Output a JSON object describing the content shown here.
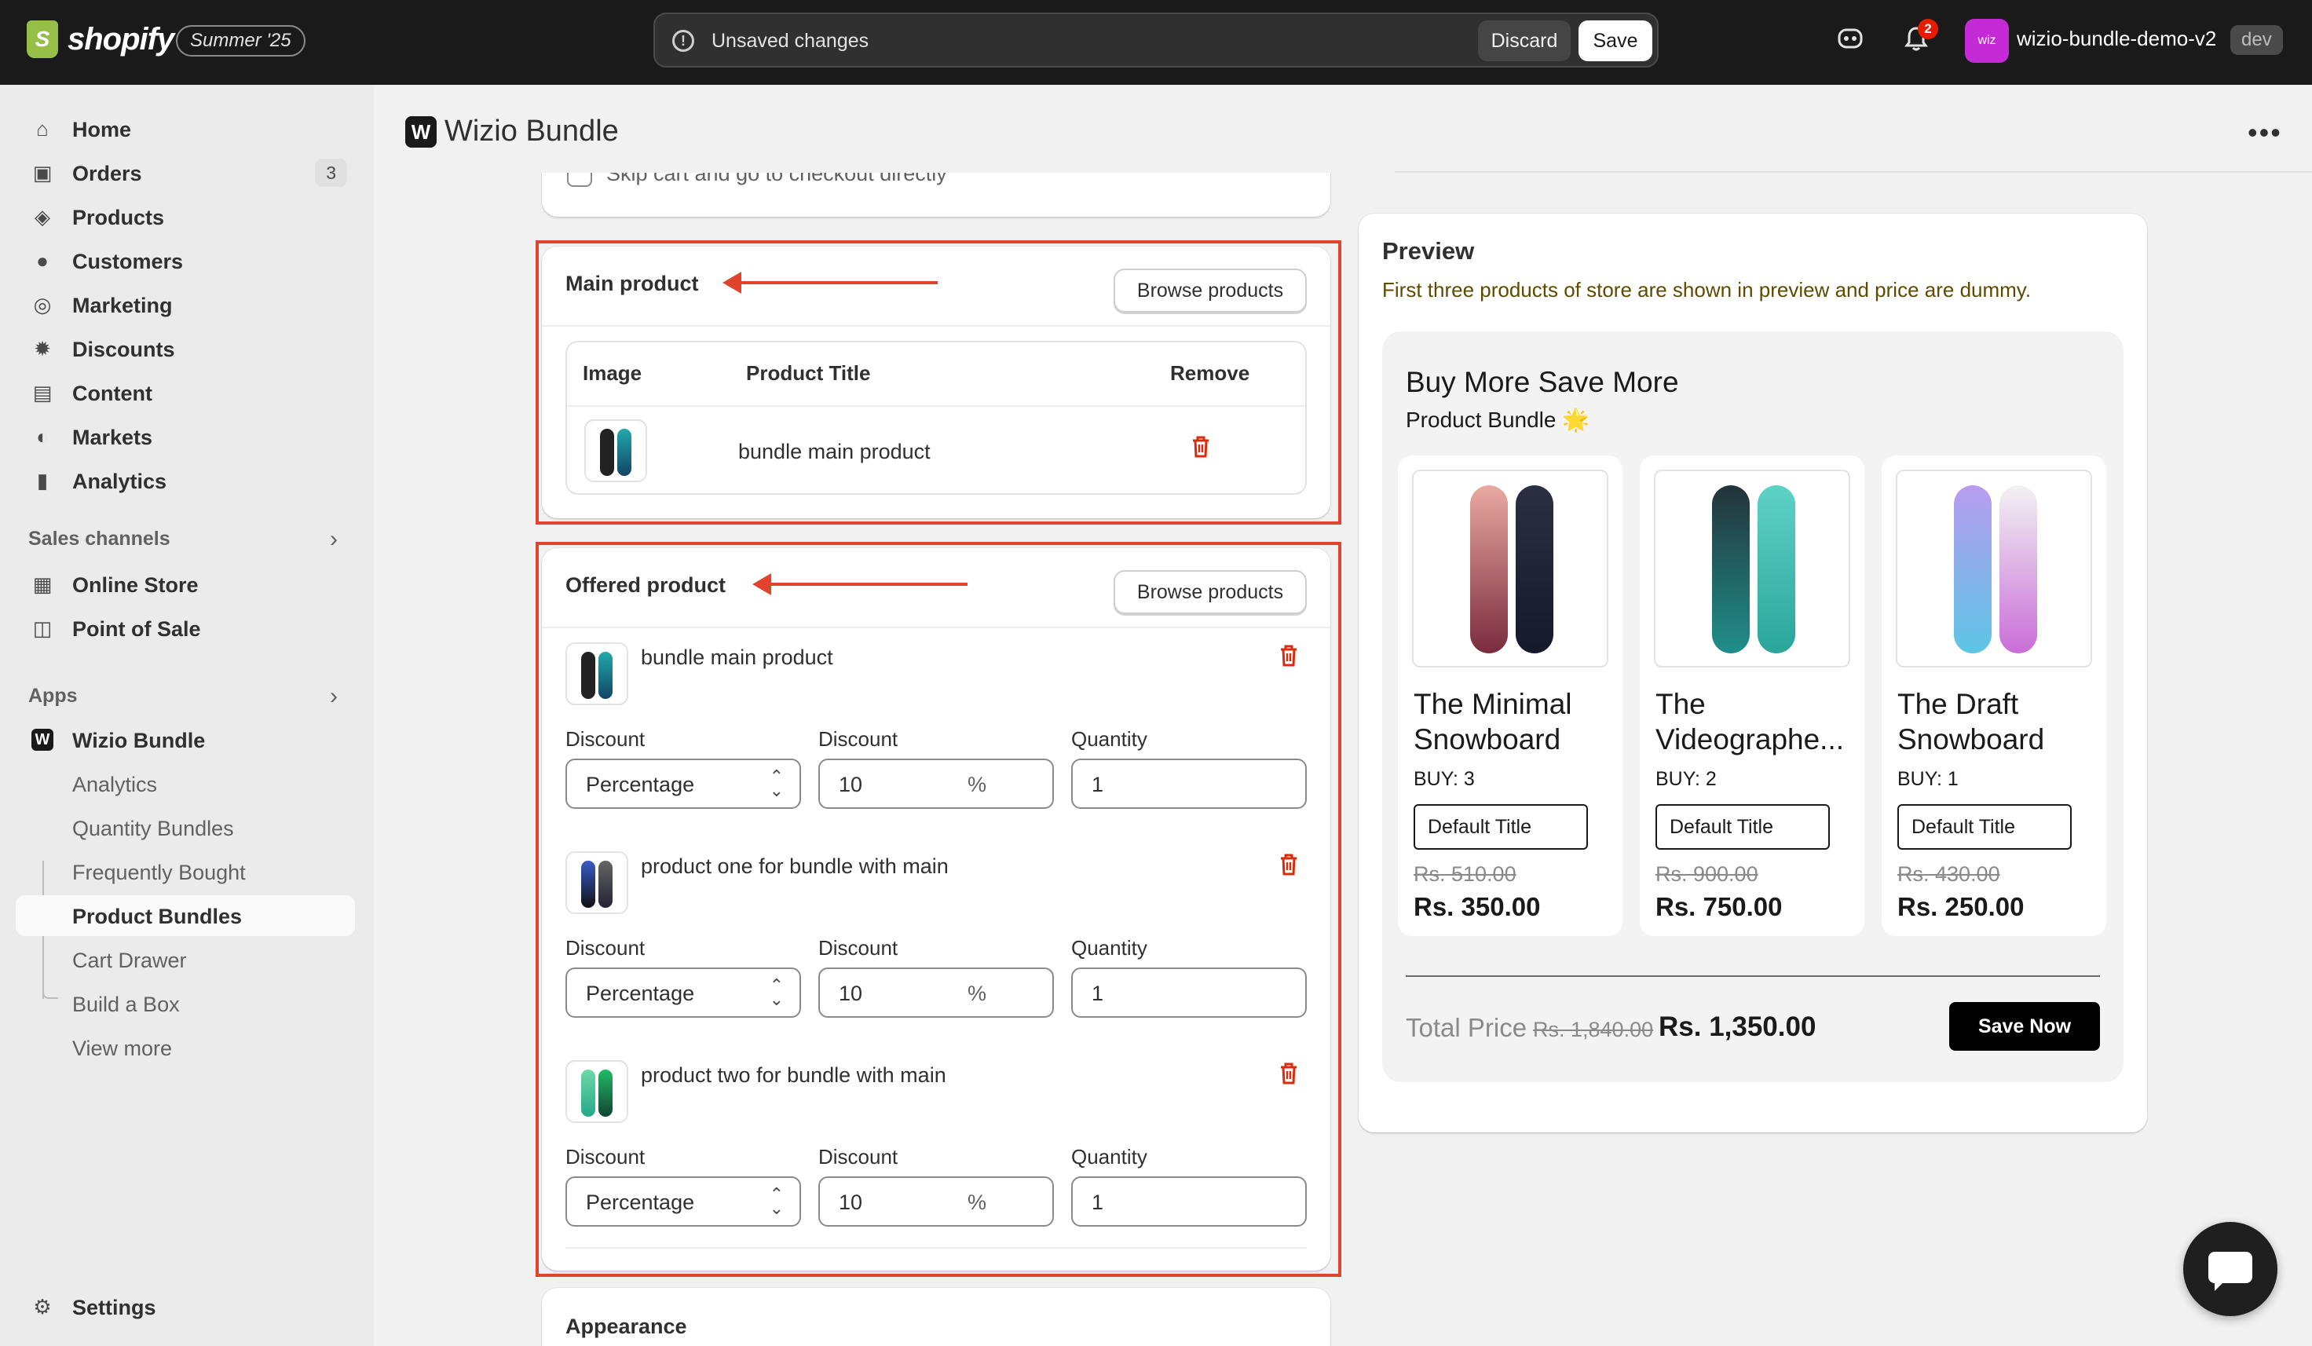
{
  "topbar": {
    "brand": "shopify",
    "edition": "Summer '25",
    "unsaved_message": "Unsaved changes",
    "discard_label": "Discard",
    "save_label": "Save",
    "notification_count": "2",
    "store_avatar_text": "wiz",
    "store_name": "wizio-bundle-demo-v2",
    "env_badge": "dev"
  },
  "sidebar": {
    "items": [
      {
        "label": "Home",
        "icon": "home-icon"
      },
      {
        "label": "Orders",
        "icon": "inbox-icon",
        "count": "3"
      },
      {
        "label": "Products",
        "icon": "tag-icon"
      },
      {
        "label": "Customers",
        "icon": "person-icon"
      },
      {
        "label": "Marketing",
        "icon": "target-icon"
      },
      {
        "label": "Discounts",
        "icon": "discount-icon"
      },
      {
        "label": "Content",
        "icon": "content-icon"
      },
      {
        "label": "Markets",
        "icon": "globe-icon"
      },
      {
        "label": "Analytics",
        "icon": "bar-chart-icon"
      }
    ],
    "sales_channels_title": "Sales channels",
    "sales_channels": [
      {
        "label": "Online Store",
        "icon": "store-icon"
      },
      {
        "label": "Point of Sale",
        "icon": "pos-icon"
      }
    ],
    "apps_title": "Apps",
    "app_name": "Wizio Bundle",
    "app_subitems": [
      "Analytics",
      "Quantity Bundles",
      "Frequently Bought",
      "Product Bundles",
      "Cart Drawer",
      "Build a Box",
      "View more"
    ],
    "settings_label": "Settings"
  },
  "header": {
    "app_logo_text": "W",
    "title": "Wizio Bundle"
  },
  "top_card": {
    "checkbox_label": "Skip cart and go to checkout directly"
  },
  "main_product": {
    "title": "Main product",
    "browse_label": "Browse products",
    "columns": [
      "Image",
      "Product Title",
      "Remove"
    ],
    "product_title": "bundle main product"
  },
  "offered_product": {
    "title": "Offered product",
    "browse_label": "Browse products",
    "discount_type_label": "Discount",
    "discount_value_label": "Discount",
    "quantity_label": "Quantity",
    "items": [
      {
        "name": "bundle main product",
        "type": "Percentage",
        "value": "10",
        "suffix": "%",
        "quantity": "1"
      },
      {
        "name": "product one for bundle with main",
        "type": "Percentage",
        "value": "10",
        "suffix": "%",
        "quantity": "1"
      },
      {
        "name": "product two for bundle with main",
        "type": "Percentage",
        "value": "10",
        "suffix": "%",
        "quantity": "1"
      }
    ]
  },
  "appearance": {
    "title": "Appearance"
  },
  "preview": {
    "title": "Preview",
    "subtitle": "First three products of store are shown in preview and price are dummy.",
    "heading": "Buy More Save More",
    "subheading": "Product Bundle 🌟",
    "products": [
      {
        "name": "The Minimal Snowboard",
        "buy": "BUY: 3",
        "variant": "Default Title",
        "old_price": "Rs. 510.00",
        "price": "Rs. 350.00"
      },
      {
        "name": "The Videographe...",
        "buy": "BUY: 2",
        "variant": "Default Title",
        "old_price": "Rs. 900.00",
        "price": "Rs. 750.00"
      },
      {
        "name": "The Draft Snowboard",
        "buy": "BUY: 1",
        "variant": "Default Title",
        "old_price": "Rs. 430.00",
        "price": "Rs. 250.00"
      }
    ],
    "total_label": "Total Price",
    "total_old": "Rs. 1,840.00",
    "total_new": "Rs. 1,350.00",
    "save_now_label": "Save Now"
  },
  "colors": {
    "accent_red": "#e0442c",
    "trash_red": "#d72c0d",
    "topbar": "#1a1a1a",
    "avatar": "#c42bd6"
  }
}
